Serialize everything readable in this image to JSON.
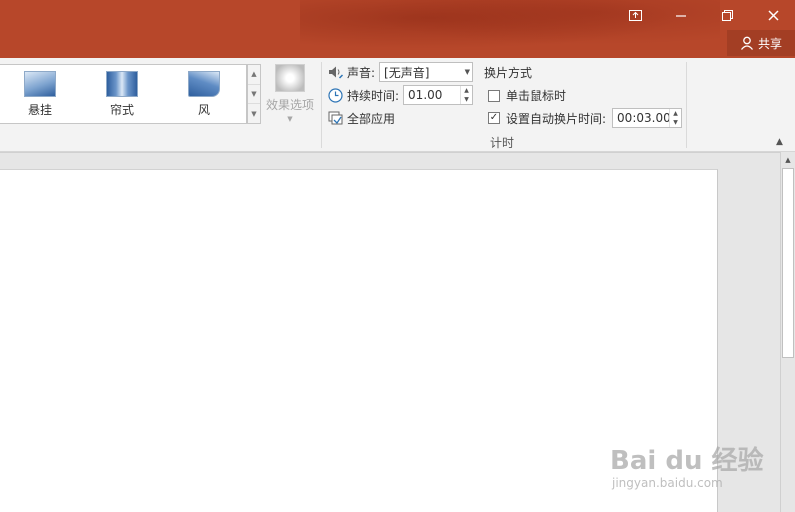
{
  "titlebar": {
    "share_label": "共享",
    "controls": [
      "ribbon-display-options",
      "minimize",
      "restore",
      "close"
    ]
  },
  "gallery": {
    "items": [
      {
        "label": "悬挂",
        "icon": "hanging-transition-icon"
      },
      {
        "label": "帘式",
        "icon": "curtains-transition-icon"
      },
      {
        "label": "风",
        "icon": "wind-transition-icon"
      }
    ]
  },
  "effect_options": {
    "label": "效果选项"
  },
  "timing": {
    "sound_label": "声音:",
    "sound_value": "[无声音]",
    "duration_label": "持续时间:",
    "duration_value": "01.00",
    "apply_all_label": "全部应用",
    "advance_title": "换片方式",
    "on_click_label": "单击鼠标时",
    "on_click_checked": false,
    "auto_after_label": "设置自动换片时间:",
    "auto_after_checked": true,
    "auto_after_value": "00:03.00",
    "group_label": "计时"
  },
  "watermark": {
    "text": "Bai du 经验",
    "sub": "jingyan.baidu.com"
  },
  "colors": {
    "titlebar": "#b7472a",
    "ribbon": "#f3f3f3",
    "workspace": "#e6e6e6"
  }
}
